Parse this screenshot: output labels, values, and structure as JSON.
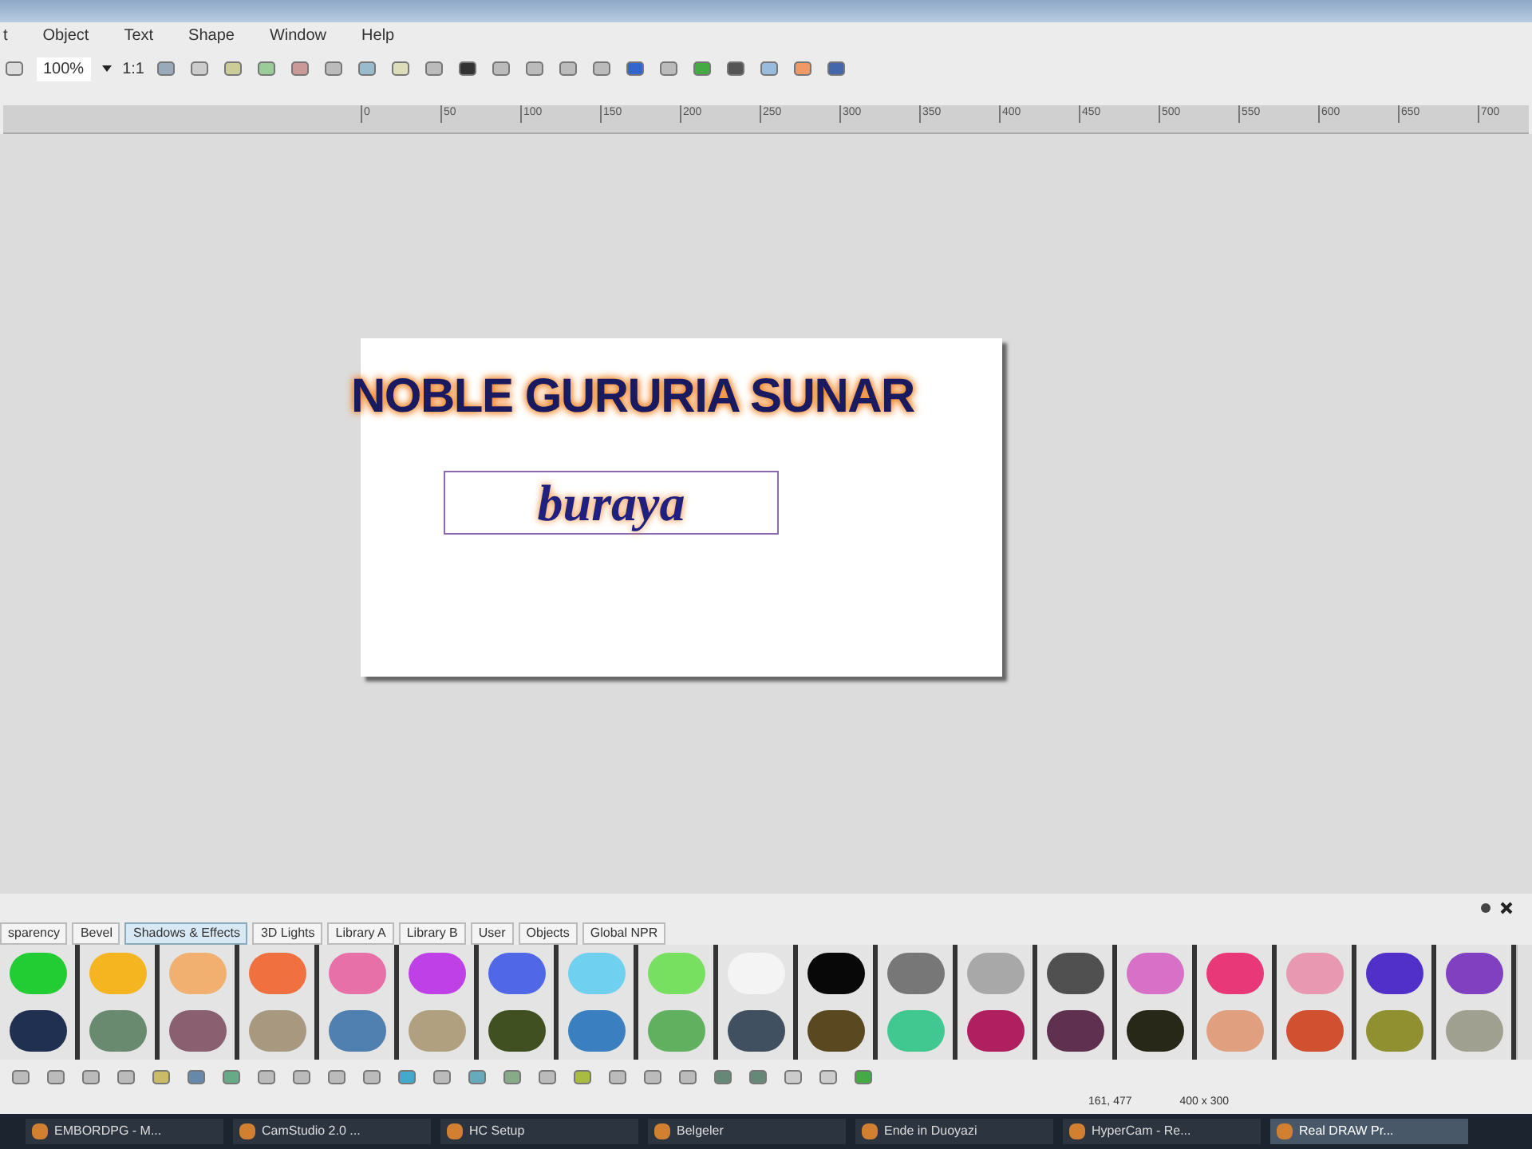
{
  "menu": [
    {
      "label": "t"
    },
    {
      "label": "Object"
    },
    {
      "label": "Text"
    },
    {
      "label": "Shape"
    },
    {
      "label": "Window"
    },
    {
      "label": "Help"
    }
  ],
  "toolbar": {
    "zoom": "100%",
    "ratio": "1:1"
  },
  "ruler": {
    "labels": [
      "0",
      "50",
      "100",
      "150",
      "200",
      "250",
      "300",
      "350",
      "400",
      "450",
      "500",
      "550",
      "600",
      "650",
      "700"
    ]
  },
  "canvas": {
    "title_text": "NOBLE GURURIA SUNAR",
    "selected_text": "buraya"
  },
  "panel": {
    "tabs": [
      {
        "label": "sparency",
        "selected": false
      },
      {
        "label": "Bevel",
        "selected": false
      },
      {
        "label": "Shadows & Effects",
        "selected": true
      },
      {
        "label": "3D Lights",
        "selected": false
      },
      {
        "label": "Library A",
        "selected": false
      },
      {
        "label": "Library B",
        "selected": false
      },
      {
        "label": "User",
        "selected": false
      },
      {
        "label": "Objects",
        "selected": false
      },
      {
        "label": "Global NPR",
        "selected": false
      }
    ],
    "swatches": [
      {
        "color": "#22cc33"
      },
      {
        "color": "#f5b520"
      },
      {
        "color": "#f2b070"
      },
      {
        "color": "#f07040"
      },
      {
        "color": "#e870a8"
      },
      {
        "color": "#c040e8"
      },
      {
        "color": "#5068e8"
      },
      {
        "color": "#70d0f0"
      },
      {
        "color": "#78e060"
      },
      {
        "color": "#f4f4f4"
      },
      {
        "color": "#080808"
      },
      {
        "color": "#777777"
      },
      {
        "color": "#a8a8a8"
      },
      {
        "color": "#505050"
      },
      {
        "color": "#d870c8"
      },
      {
        "color": "#e83878"
      },
      {
        "color": "#e898b0"
      },
      {
        "color": "#5030c8"
      },
      {
        "color": "#8040c0"
      }
    ],
    "patterns": [
      {
        "color": "#203050"
      },
      {
        "color": "#6a8a70"
      },
      {
        "color": "#8a6070"
      },
      {
        "color": "#a89880"
      },
      {
        "color": "#5080b0"
      },
      {
        "color": "#b0a080"
      },
      {
        "color": "#405020"
      },
      {
        "color": "#3a80c0"
      },
      {
        "color": "#60b060"
      },
      {
        "color": "#405060"
      },
      {
        "color": "#5a4820"
      },
      {
        "color": "#40c890"
      },
      {
        "color": "#b02060"
      },
      {
        "color": "#603050"
      },
      {
        "color": "#282818"
      },
      {
        "color": "#e0a080"
      },
      {
        "color": "#d05030"
      },
      {
        "color": "#909030"
      },
      {
        "color": "#a0a090"
      }
    ]
  },
  "status_bar": {
    "position": "161, 477",
    "size": "400 x 300"
  },
  "taskbar": [
    {
      "label": "EMBORDPG - M...",
      "selected": false
    },
    {
      "label": "CamStudio 2.0 ...",
      "selected": false
    },
    {
      "label": "HC Setup",
      "selected": false
    },
    {
      "label": "Belgeler",
      "selected": false
    },
    {
      "label": "Ende in Duoyazi",
      "selected": false
    },
    {
      "label": "HyperCam - Re...",
      "selected": false
    },
    {
      "label": "Real DRAW Pr...",
      "selected": true
    }
  ]
}
